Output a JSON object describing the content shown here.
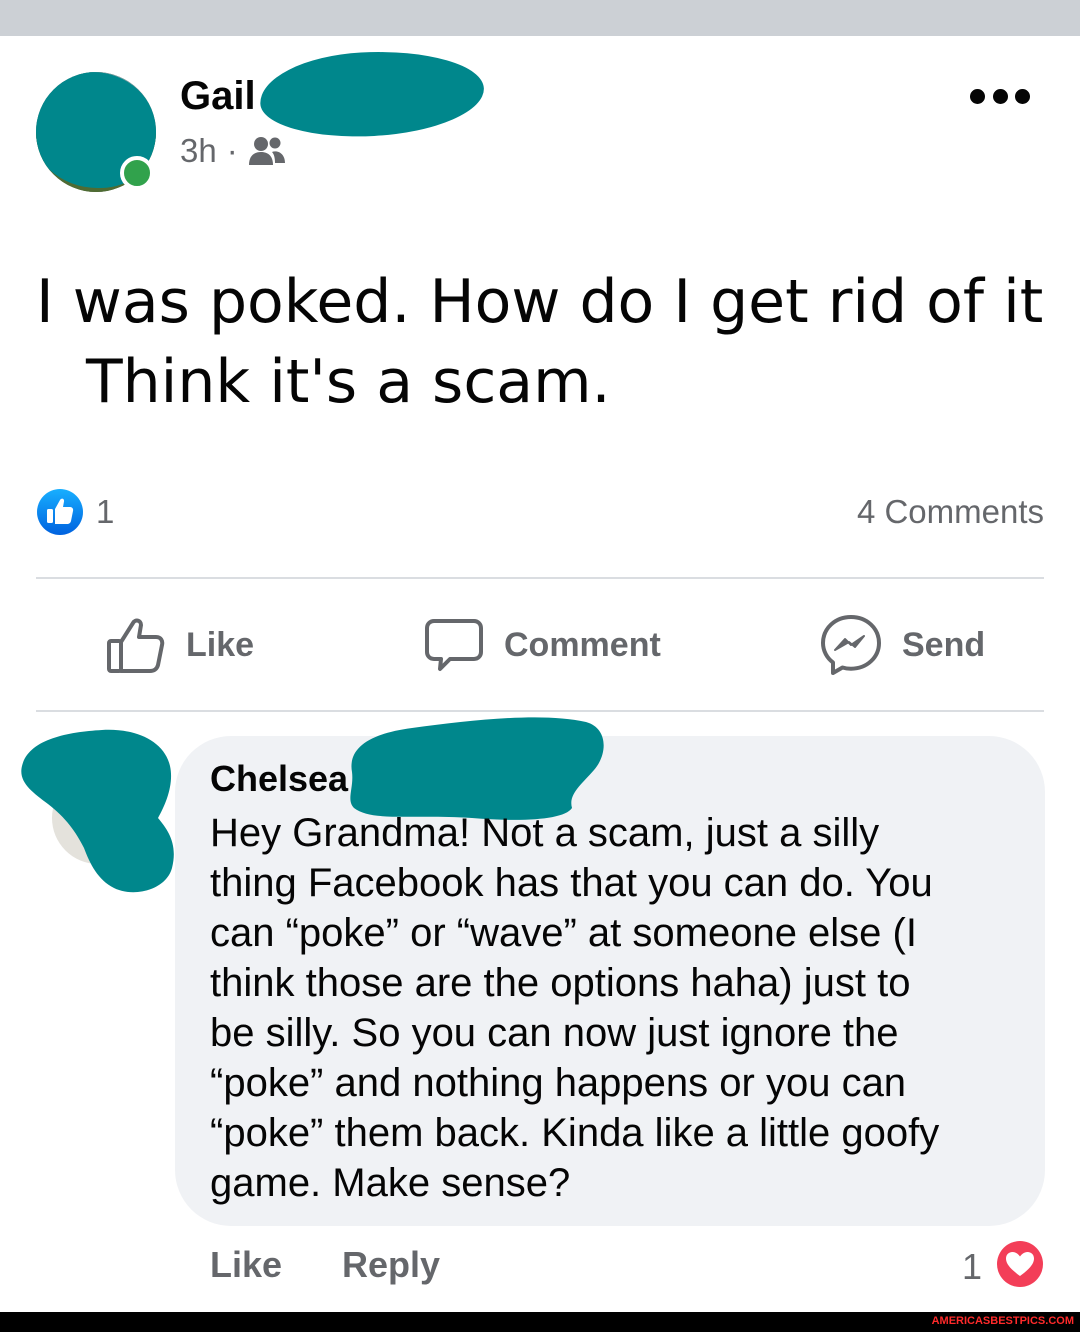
{
  "post": {
    "author_name": "Gail",
    "timestamp": "3h",
    "separator": "·",
    "audience_icon": "friends-icon",
    "text_line1": "I was poked. How do I get rid of it",
    "text_line2": "Think it's a scam.",
    "like_count": "1",
    "comments_count": "4 Comments"
  },
  "actions": {
    "like": "Like",
    "comment": "Comment",
    "send": "Send"
  },
  "comment": {
    "author_name": "Chelsea",
    "lines": [
      "Hey Grandma! Not a scam, just a silly",
      "thing Facebook has that you can do. You",
      "can “poke” or “wave” at someone else (I",
      "think those are the options haha) just to",
      "be silly. So you can now just ignore the",
      "“poke” and nothing happens or you can",
      "“poke” them back. Kinda like a little goofy",
      "game. Make sense?"
    ],
    "like_label": "Like",
    "reply_label": "Reply",
    "reaction_count": "1",
    "reaction_icon": "love-icon"
  },
  "watermark": "AMERICASBESTPICS.COM",
  "colors": {
    "redaction": "#00878c",
    "facebook_blue": "#1877f2",
    "online_green": "#31a24c",
    "love_red": "#f33e58",
    "secondary_text": "#65676b"
  }
}
